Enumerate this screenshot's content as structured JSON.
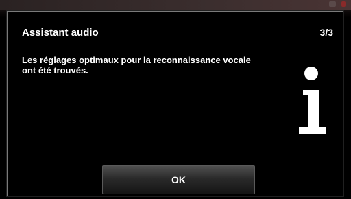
{
  "dialog": {
    "title": "Assistant audio",
    "step": "3/3",
    "message": "Les réglages optimaux pour la reconnaissance vocale ont été trouvés.",
    "icon": "info-icon",
    "ok_label": "OK"
  },
  "colors": {
    "background": "#000000",
    "text": "#ffffff",
    "border": "#7a7a7a"
  }
}
